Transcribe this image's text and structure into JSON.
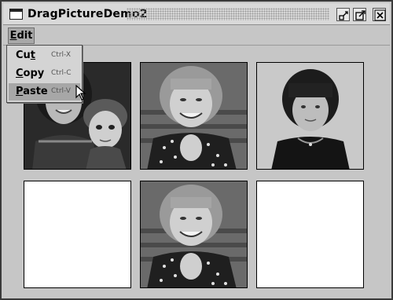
{
  "window": {
    "title": "DragPictureDemo2"
  },
  "menubar": {
    "edit_first": "E",
    "edit_rest": "dit"
  },
  "edit_menu": {
    "items": [
      {
        "label_pre": "Cu",
        "label_ul": "t",
        "label_post": "",
        "accelerator": "Ctrl-X"
      },
      {
        "label_pre": "",
        "label_ul": "C",
        "label_post": "opy",
        "accelerator": "Ctrl-C"
      },
      {
        "label_pre": "",
        "label_ul": "P",
        "label_post": "aste",
        "accelerator": "Ctrl-V"
      }
    ],
    "selected_index": 2
  },
  "grid": {
    "cells": [
      {
        "content": "photo",
        "subject": "mother-and-daughter-with-doll"
      },
      {
        "content": "photo",
        "subject": "smiling-girl-polka-dot-dress"
      },
      {
        "content": "photo",
        "subject": "girl-with-bangs"
      },
      {
        "content": "empty"
      },
      {
        "content": "photo",
        "subject": "smiling-girl-polka-dot-dress"
      },
      {
        "content": "empty"
      }
    ]
  },
  "colors": {
    "window_bg": "#c6c6c6",
    "selection": "#a7a7a7"
  }
}
